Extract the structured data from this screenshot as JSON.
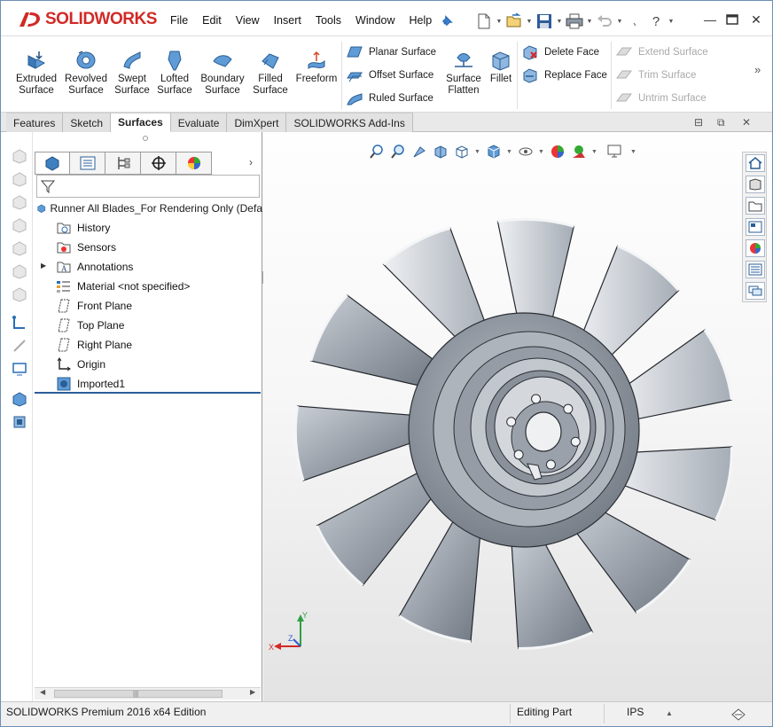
{
  "app": {
    "logo_text": "SOLIDWORKS"
  },
  "menu": [
    "File",
    "Edit",
    "View",
    "Insert",
    "Tools",
    "Window",
    "Help"
  ],
  "ribbon": {
    "big_buttons": [
      {
        "name": "extruded-surface-button",
        "line1": "Extruded",
        "line2": "Surface"
      },
      {
        "name": "revolved-surface-button",
        "line1": "Revolved",
        "line2": "Surface"
      },
      {
        "name": "swept-surface-button",
        "line1": "Swept",
        "line2": "Surface"
      },
      {
        "name": "lofted-surface-button",
        "line1": "Lofted",
        "line2": "Surface"
      },
      {
        "name": "boundary-surface-button",
        "line1": "Boundary",
        "line2": "Surface"
      },
      {
        "name": "filled-surface-button",
        "line1": "Filled",
        "line2": "Surface"
      },
      {
        "name": "freeform-button",
        "line1": "Freeform",
        "line2": ""
      }
    ],
    "small_col1": [
      "Planar Surface",
      "Offset Surface",
      "Ruled Surface"
    ],
    "flatten": {
      "line1": "Surface",
      "line2": "Flatten"
    },
    "fillet": "Fillet",
    "small_col2": [
      "Delete Face",
      "Replace Face"
    ],
    "small_col3": [
      "Extend Surface",
      "Trim Surface",
      "Untrim Surface"
    ]
  },
  "tabs": [
    {
      "label": "Features",
      "active": false
    },
    {
      "label": "Sketch",
      "active": false
    },
    {
      "label": "Surfaces",
      "active": true
    },
    {
      "label": "Evaluate",
      "active": false
    },
    {
      "label": "DimXpert",
      "active": false
    },
    {
      "label": "SOLIDWORKS Add-Ins",
      "active": false
    }
  ],
  "tree": {
    "root": "Runner All Blades_For Rendering Only  (Defa",
    "items": [
      "History",
      "Sensors",
      "Annotations",
      "Material <not specified>",
      "Front Plane",
      "Top Plane",
      "Right Plane",
      "Origin",
      "Imported1"
    ]
  },
  "status": {
    "edition": "SOLIDWORKS Premium 2016 x64 Edition",
    "mode": "Editing Part",
    "units": "IPS"
  },
  "colors": {
    "accent": "#d12a26",
    "select": "#2c5d9a",
    "part": "#9aa3ad"
  }
}
